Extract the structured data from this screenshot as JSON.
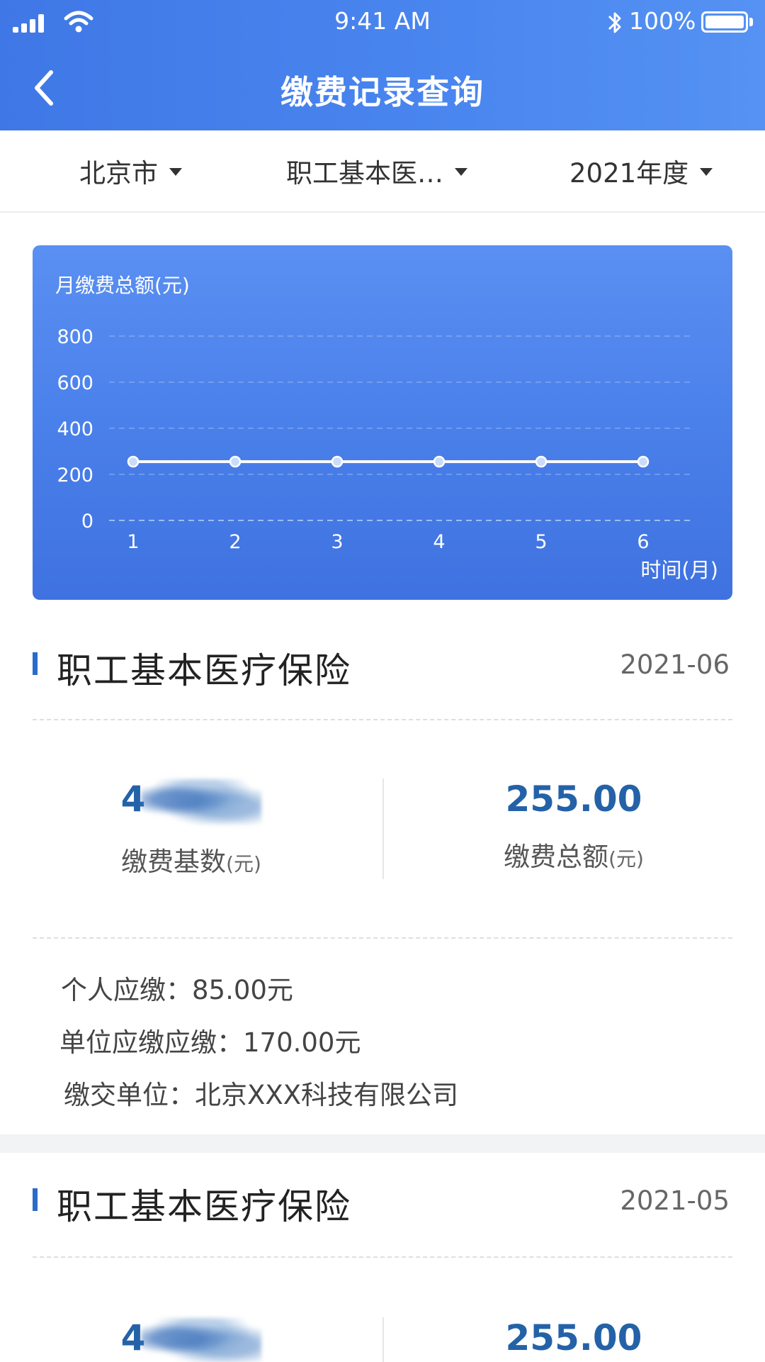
{
  "status_bar": {
    "time": "9:41 AM",
    "battery": "100%"
  },
  "header": {
    "title": "缴费记录查询",
    "back_icon": "chevron-left-icon"
  },
  "filters": [
    {
      "label": "北京市"
    },
    {
      "label": "职工基本医…"
    },
    {
      "label": "2021年度"
    }
  ],
  "chart_data": {
    "type": "line",
    "title": "月缴费总额(元)",
    "xlabel": "时间(月)",
    "ylabel": "",
    "x": [
      1,
      2,
      3,
      4,
      5,
      6
    ],
    "series": [
      {
        "values": [
          255,
          255,
          255,
          255,
          255,
          255
        ]
      }
    ],
    "yticks": [
      0,
      200,
      400,
      600,
      800
    ],
    "ylim": [
      0,
      800
    ],
    "grid": true,
    "colors": {
      "line": "#ffffff",
      "grid": "#9dbdf7"
    }
  },
  "records": [
    {
      "title": "职工基本医疗保险",
      "date": "2021-06",
      "base_value": "4",
      "base_label": "缴费基数",
      "total_value": "255.00",
      "total_label": "缴费总额",
      "unit": "(元)",
      "personal": "个人应缴：85.00元",
      "company": "单位应缴应缴：170.00元",
      "employer": "缴交单位：北京XXX科技有限公司"
    },
    {
      "title": "职工基本医疗保险",
      "date": "2021-05",
      "base_value": "4",
      "total_value": "255.00"
    }
  ],
  "colors": {
    "accent": "#4a86ef",
    "value": "#2462a8"
  }
}
